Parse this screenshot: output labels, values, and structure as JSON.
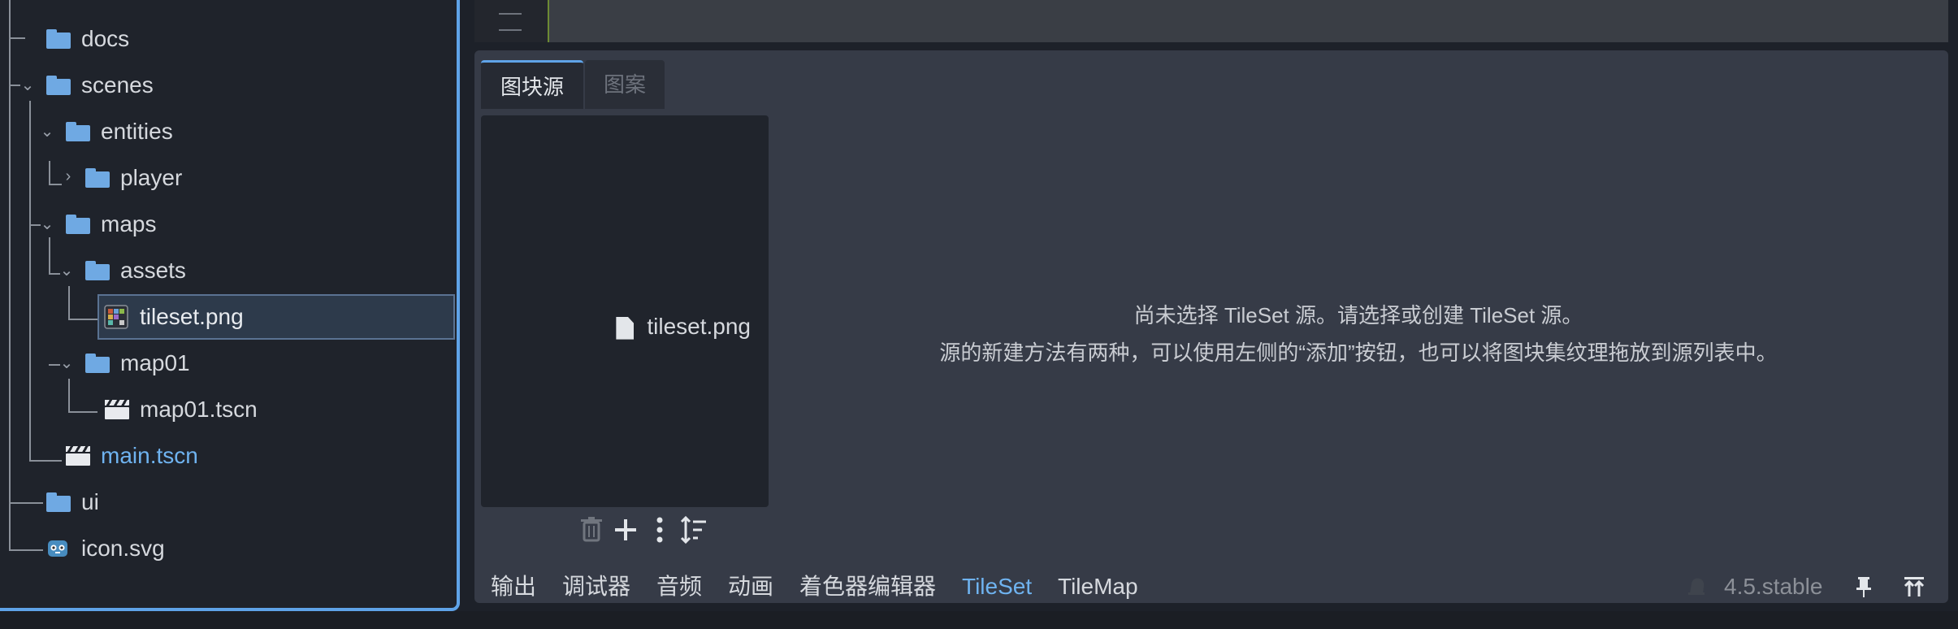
{
  "file_tree": {
    "items": [
      {
        "label": "docs",
        "type": "folder"
      },
      {
        "label": "scenes",
        "type": "folder"
      },
      {
        "label": "entities",
        "type": "folder"
      },
      {
        "label": "player",
        "type": "folder"
      },
      {
        "label": "maps",
        "type": "folder"
      },
      {
        "label": "assets",
        "type": "folder"
      },
      {
        "label": "tileset.png",
        "type": "image",
        "selected": true
      },
      {
        "label": "map01",
        "type": "folder"
      },
      {
        "label": "map01.tscn",
        "type": "scene"
      },
      {
        "label": "main.tscn",
        "type": "scene",
        "highlighted": true
      },
      {
        "label": "ui",
        "type": "folder"
      },
      {
        "label": "icon.svg",
        "type": "svg"
      }
    ]
  },
  "tileset_editor": {
    "tabs": [
      {
        "label": "图块源",
        "active": true
      },
      {
        "label": "图案",
        "active": false
      }
    ],
    "sources": [
      {
        "label": "tileset.png"
      }
    ],
    "empty_message_line1": "尚未选择 TileSet 源。请选择或创建 TileSet 源。",
    "empty_message_line2": "源的新建方法有两种，可以使用左侧的“添加”按钮，也可以将图块集纹理拖放到源列表中。",
    "toolbar_icons": [
      "trash-icon",
      "plus-icon",
      "kebab-menu-icon",
      "sort-icon"
    ]
  },
  "bottom_bar": {
    "tabs": [
      {
        "label": "输出"
      },
      {
        "label": "调试器"
      },
      {
        "label": "音频"
      },
      {
        "label": "动画"
      },
      {
        "label": "着色器编辑器"
      },
      {
        "label": "TileSet",
        "active": true
      },
      {
        "label": "TileMap"
      }
    ],
    "version": "4.5.stable"
  },
  "colors": {
    "accent": "#5fa3e8",
    "folder": "#6fa9e3",
    "active_text": "#6fb3f0",
    "panel_bg": "#363b47",
    "tree_bg": "#1f232b"
  }
}
